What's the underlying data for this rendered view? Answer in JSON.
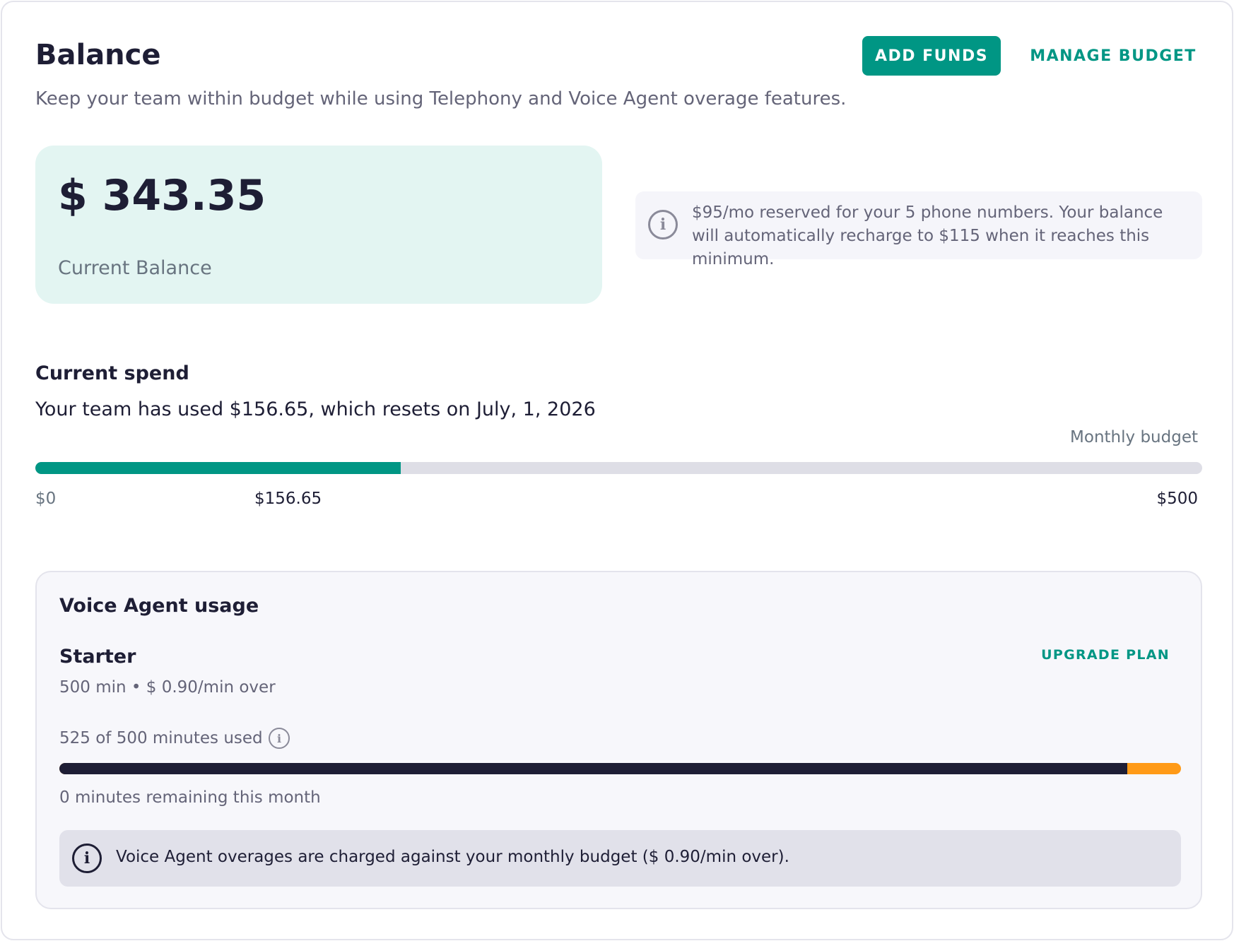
{
  "header": {
    "title": "Balance",
    "subtitle": "Keep your team within budget while using Telephony and Voice Agent overage features.",
    "add_funds_label": "ADD FUNDS",
    "manage_budget_label": "MANAGE BUDGET"
  },
  "balance": {
    "amount": "$ 343.35",
    "label": "Current Balance"
  },
  "reserve_info": {
    "icon": "info-icon",
    "text": "$95/mo reserved for your 5 phone numbers. Your balance will automatically recharge to $115 when it reaches this minimum."
  },
  "spend": {
    "title": "Current spend",
    "description": "Your team has used $156.65, which resets on July, 1, 2026",
    "budget_label": "Monthly budget",
    "min_label": "$0",
    "used_label": "$156.65",
    "max_label": "$500",
    "used_value": 156.65,
    "budget_value": 500
  },
  "voice_agent": {
    "title": "Voice Agent usage",
    "plan_name": "Starter",
    "plan_detail": "500 min • $ 0.90/min over",
    "upgrade_label": "UPGRADE PLAN",
    "minutes_used_text": "525 of 500 minutes used",
    "minutes_used": 525,
    "minutes_included": 500,
    "remaining_text": "0 minutes remaining this month",
    "notice_text": "Voice Agent overages are charged against your monthly budget ($ 0.90/min over)."
  },
  "colors": {
    "accent": "#009684",
    "balance_bg": "#e3f5f2",
    "usage_bar": "#1e1e35",
    "overage_bar": "#ff9a17"
  }
}
